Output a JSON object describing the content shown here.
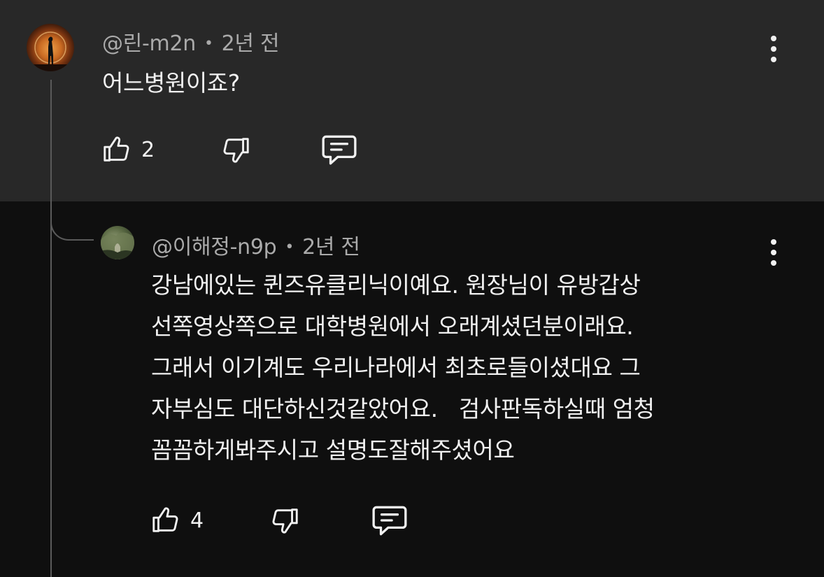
{
  "comments": [
    {
      "author": "@린-m2n",
      "separator": "•",
      "time": "2년 전",
      "text_lines": [
        "어느병원이죠?"
      ],
      "likes": "2",
      "avatar_icon": "moon-silhouette-avatar"
    },
    {
      "author": "@이해정-n9p",
      "separator": "•",
      "time": "2년 전",
      "text_lines": [
        "강남에있는 퀸즈유클리닉이예요. 원장님이 유방갑상",
        "선쪽영상쪽으로 대학병원에서 오래계셨던분이래요.",
        "그래서 이기계도 우리나라에서 최초로들이셨대요 그",
        "자부심도 대단하신것같았어요.   검사판독하실때 엄청",
        "꼼꼼하게봐주시고 설명도잘해주셨어요"
      ],
      "likes": "4",
      "avatar_icon": "nature-avatar"
    }
  ],
  "colors": {
    "parent_bg": "#282828",
    "page_bg": "#0f0f0f",
    "meta_text": "#aaaaaa",
    "body_text": "#f1f1f1",
    "thread_line": "#5a5a5a"
  }
}
